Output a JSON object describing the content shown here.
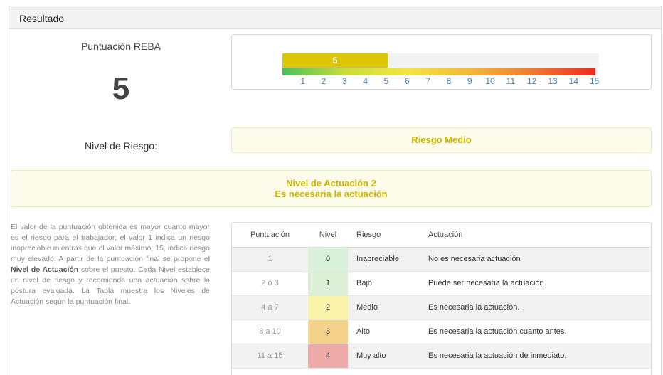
{
  "panel": {
    "title": "Resultado"
  },
  "score": {
    "label": "Puntuación REBA",
    "value": "5"
  },
  "scale": {
    "current": "5",
    "current_value": 5,
    "min": 1,
    "max": 15,
    "ticks": [
      "1",
      "2",
      "3",
      "4",
      "5",
      "6",
      "7",
      "8",
      "9",
      "10",
      "11",
      "12",
      "13",
      "14",
      "15"
    ],
    "fill_color": "#dcc600",
    "gradient_colors": [
      "#46c05a",
      "#c8de3a",
      "#f3e640",
      "#f5b63a",
      "#f07a2e",
      "#ee2a22"
    ]
  },
  "risk": {
    "label": "Nivel de Riesgo:",
    "value": "Riesgo Medio",
    "color": "#cbb400"
  },
  "action": {
    "line1": "Nivel de Actuación 2",
    "line2": "Es necesaria la actuación"
  },
  "description": {
    "part1": "El valor de la puntuación obtenida es mayor cuanto mayor es el riesgo para el trabajador; el valor 1 indica un riesgo inapreciable mientras que el valor máximo, 15, indica riesgo muy elevado. A partir de la puntuación final se propone el ",
    "bold": "Nivel de Actuación",
    "part2": " sobre el puesto. Cada Nivel establece un nivel de riesgo y recomienda una actuación sobre la postura evaluada. La Tabla muestra los Niveles de Actuación según la puntuación final."
  },
  "table": {
    "headers": [
      "Puntuación",
      "Nivel",
      "Riesgo",
      "Actuación"
    ],
    "rows": [
      {
        "score": "1",
        "level": "0",
        "risk": "Inapreciable",
        "action": "No es necesaria actuación",
        "level_color": "#d9f2d9"
      },
      {
        "score": "2 o 3",
        "level": "1",
        "risk": "Bajo",
        "action": "Puede ser necesaria la actuación.",
        "level_color": "#dcf0d8"
      },
      {
        "score": "4 a 7",
        "level": "2",
        "risk": "Medio",
        "action": "Es necesaria la actuación.",
        "level_color": "#f8f3a8"
      },
      {
        "score": "8 a 10",
        "level": "3",
        "risk": "Alto",
        "action": "Es necesaria la actuación cuanto antes.",
        "level_color": "#f4d28a"
      },
      {
        "score": "11 a 15",
        "level": "4",
        "risk": "Muy alto",
        "action": "Es necesaria la actuación de inmediato.",
        "level_color": "#eeaaa8"
      }
    ]
  }
}
